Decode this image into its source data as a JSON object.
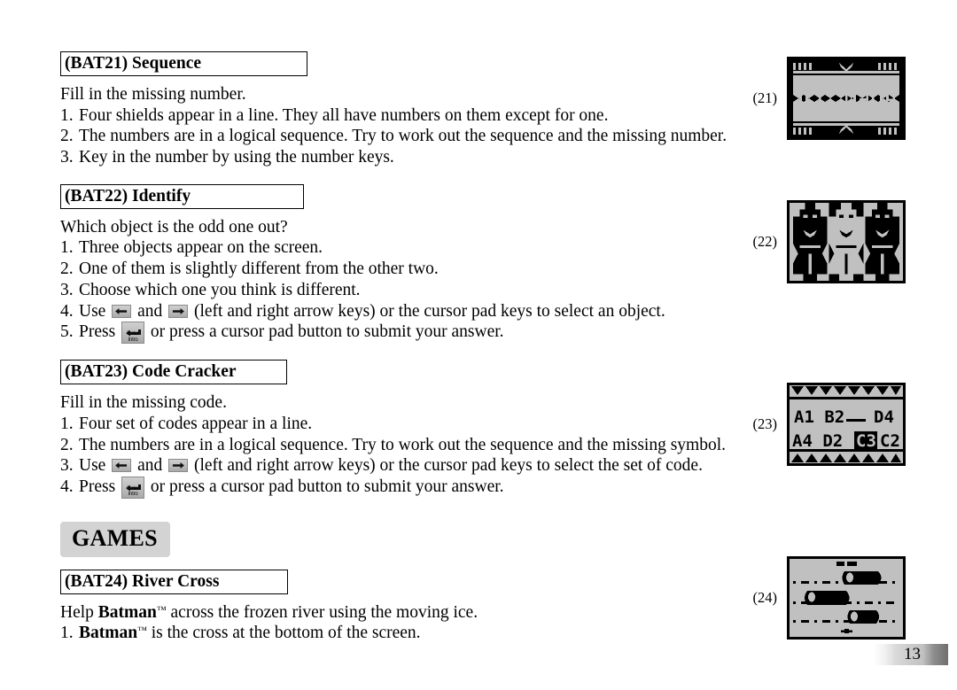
{
  "page": {
    "number": "13",
    "banner_label": "GAMES"
  },
  "keys": {
    "left_arrow": "left-arrow-key",
    "right_arrow": "right-arrow-key",
    "enter_line1": "Enter",
    "enter_line2": "Intro"
  },
  "sections": [
    {
      "id": "bat21",
      "heading": "(BAT21) Sequence",
      "intro": "Fill in the missing number.",
      "steps": [
        {
          "num": "1.",
          "text": "Four shields appear in a line. They all have numbers on them except for one."
        },
        {
          "num": "2.",
          "text": "The numbers are in a logical sequence. Try to work out the sequence and the missing number."
        },
        {
          "num": "3.",
          "text": "Key in the number by using the number keys."
        }
      ],
      "figure_caption": "(21)"
    },
    {
      "id": "bat22",
      "heading": "(BAT22) Identify",
      "intro": "Which object is the odd one out?",
      "steps": [
        {
          "num": "1.",
          "text": "Three objects appear on the screen."
        },
        {
          "num": "2.",
          "text": "One of them is slightly different from the other two."
        },
        {
          "num": "3.",
          "text": "Choose which one you think is different."
        },
        {
          "num": "4.",
          "pre": "Use ",
          "mid": " and ",
          "post": " (left and right arrow keys) or the cursor pad keys to select an object."
        },
        {
          "num": "5.",
          "pre": "Press ",
          "post": " or press a cursor pad button to submit your answer."
        }
      ],
      "figure_caption": "(22)"
    },
    {
      "id": "bat23",
      "heading": "(BAT23) Code Cracker",
      "intro": "Fill in the missing code.",
      "steps": [
        {
          "num": "1.",
          "text": "Four set of codes appear in a line."
        },
        {
          "num": "2.",
          "text": "The numbers are in a logical sequence. Try to work out the sequence and the missing symbol."
        },
        {
          "num": "3.",
          "pre": "Use ",
          "mid": " and ",
          "post": " (left and right arrow keys) or the cursor pad keys to select the set of code."
        },
        {
          "num": "4.",
          "pre": "Press ",
          "post": " or press a cursor pad button to submit your answer."
        }
      ],
      "figure_caption": "(23)"
    },
    {
      "id": "bat24",
      "heading": "(BAT24) River Cross",
      "intro_parts": {
        "a": "Help ",
        "brand": "Batman",
        "tm": "™",
        "b": " across the frozen river using the moving ice."
      },
      "steps": [
        {
          "num": "1.",
          "brand": "Batman",
          "tm": "™",
          "text": " is the cross at the bottom of the screen."
        }
      ],
      "figure_caption": "(24)"
    }
  ],
  "screens": {
    "bat21": {
      "name": "shield-sequence-screen",
      "values": [
        "11",
        "_",
        "13",
        "14"
      ],
      "description": "Four shields in a line, third value missing"
    },
    "bat22": {
      "name": "identify-screen",
      "figures": [
        "normal",
        "inverted",
        "normal"
      ],
      "description": "Three Batman figures, middle one inverted"
    },
    "bat23": {
      "name": "code-cracker-screen",
      "row_top": [
        "A1",
        "B2",
        "__",
        "D4"
      ],
      "row_bottom": [
        "A4",
        "D2",
        "C3",
        "C2"
      ],
      "selected": "C3"
    },
    "bat24": {
      "name": "river-cross-screen",
      "description": "Moving ice floes on a frozen river with Batman cross at the bottom"
    }
  },
  "colors": {
    "lcd_background": "#c0c0c0",
    "lcd_ink": "#000000",
    "key_face": "#bdbdbd",
    "banner_background": "#d3d3d3"
  }
}
